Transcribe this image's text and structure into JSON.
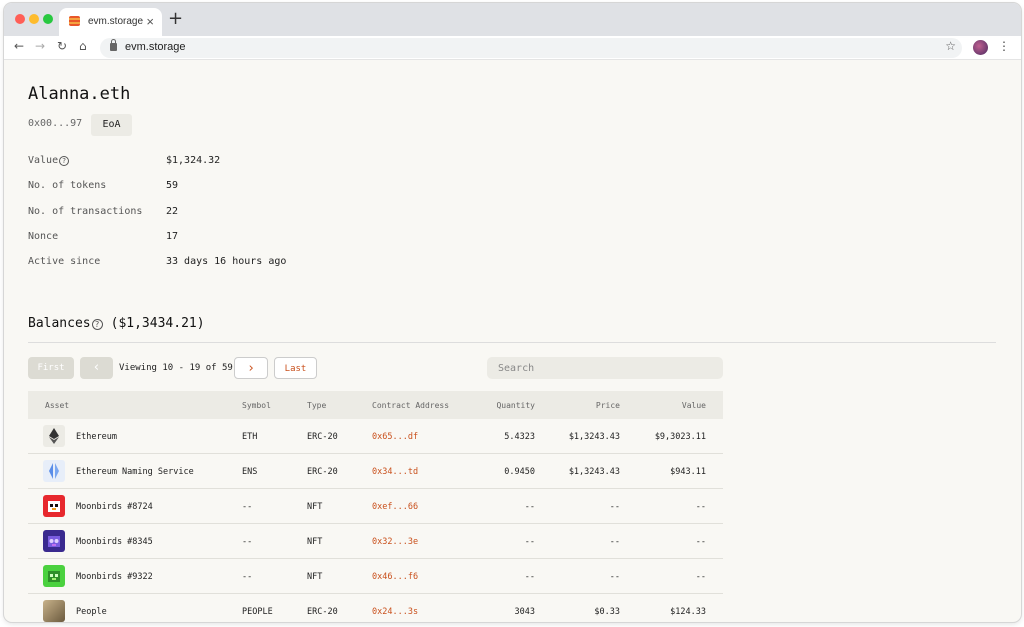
{
  "browser": {
    "tab_title": "evm.storage",
    "new_tab": "+",
    "url": "evm.storage"
  },
  "profile": {
    "name": "Alanna.eth",
    "address": "0x00...97",
    "account_type": "EoA"
  },
  "stats": [
    {
      "label": "Value",
      "value": "$1,324.32",
      "help": true
    },
    {
      "label": "No. of tokens",
      "value": "59"
    },
    {
      "label": "No. of transactions",
      "value": "22"
    },
    {
      "label": "Nonce",
      "value": "17"
    },
    {
      "label": "Active since",
      "value": "33 days 16 hours ago"
    }
  ],
  "balances": {
    "title": "Balances",
    "total": "($1,3434.21)",
    "pagination": {
      "first": "First",
      "viewing": "Viewing 10 - 19 of 59",
      "last": "Last"
    },
    "search_placeholder": "Search",
    "columns": {
      "asset": "Asset",
      "symbol": "Symbol",
      "type": "Type",
      "contract": "Contract Address",
      "quantity": "Quantity",
      "price": "Price",
      "value": "Value"
    },
    "rows": [
      {
        "icon": "ethereum-icon",
        "asset": "Ethereum",
        "symbol": "ETH",
        "type": "ERC-20",
        "contract": "0x65...df",
        "quantity": "5.4323",
        "price": "$1,3243.43",
        "value": "$9,3023.11"
      },
      {
        "icon": "ens-icon",
        "asset": "Ethereum Naming Service",
        "symbol": "ENS",
        "type": "ERC-20",
        "contract": "0x34...td",
        "quantity": "0.9450",
        "price": "$1,3243.43",
        "value": "$943.11"
      },
      {
        "icon": "moonbird-icon",
        "asset": "Moonbirds #8724",
        "symbol": "--",
        "type": "NFT",
        "contract": "0xef...66",
        "quantity": "--",
        "price": "--",
        "value": "--"
      },
      {
        "icon": "moonbird-icon",
        "asset": "Moonbirds #8345",
        "symbol": "--",
        "type": "NFT",
        "contract": "0x32...3e",
        "quantity": "--",
        "price": "--",
        "value": "--"
      },
      {
        "icon": "moonbird-icon",
        "asset": "Moonbirds #9322",
        "symbol": "--",
        "type": "NFT",
        "contract": "0x46...f6",
        "quantity": "--",
        "price": "--",
        "value": "--"
      },
      {
        "icon": "people-icon",
        "asset": "People",
        "symbol": "PEOPLE",
        "type": "ERC-20",
        "contract": "0x24...3s",
        "quantity": "3043",
        "price": "$0.33",
        "value": "$124.33"
      }
    ]
  }
}
